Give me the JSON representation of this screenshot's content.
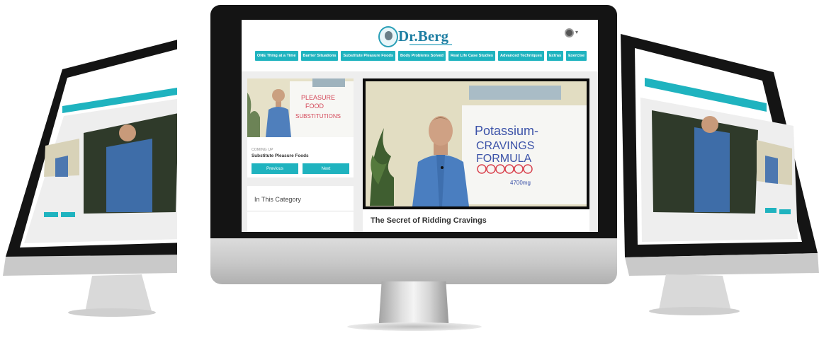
{
  "brand": {
    "logo_text": "Dr.Berg"
  },
  "nav": {
    "items": [
      "ONE Thing at a Time",
      "Barrier Situations",
      "Substitute Pleasure Foods",
      "Body Problems Solved",
      "Real Life Case Studies",
      "Advanced Techniques",
      "Extras",
      "Exercise"
    ]
  },
  "sidebar": {
    "coming_up_label": "COMING UP",
    "coming_up_title": "Substitute Pleasure Foods",
    "previous_label": "Previous",
    "next_label": "Next",
    "category_title": "In This Category",
    "thumb_board_text": [
      "PLEASURE",
      "FOOD",
      "SUBSTITUTIONS"
    ]
  },
  "main": {
    "video_title": "The Secret of Ridding Cravings",
    "board_text": [
      "Potassium-",
      "CRAVINGS",
      "FORMULA",
      "4700mg"
    ]
  },
  "colors": {
    "accent": "#1fb3bf",
    "logo": "#1f7fa3",
    "bezel": "#141414",
    "content_bg": "#eeeeee"
  }
}
